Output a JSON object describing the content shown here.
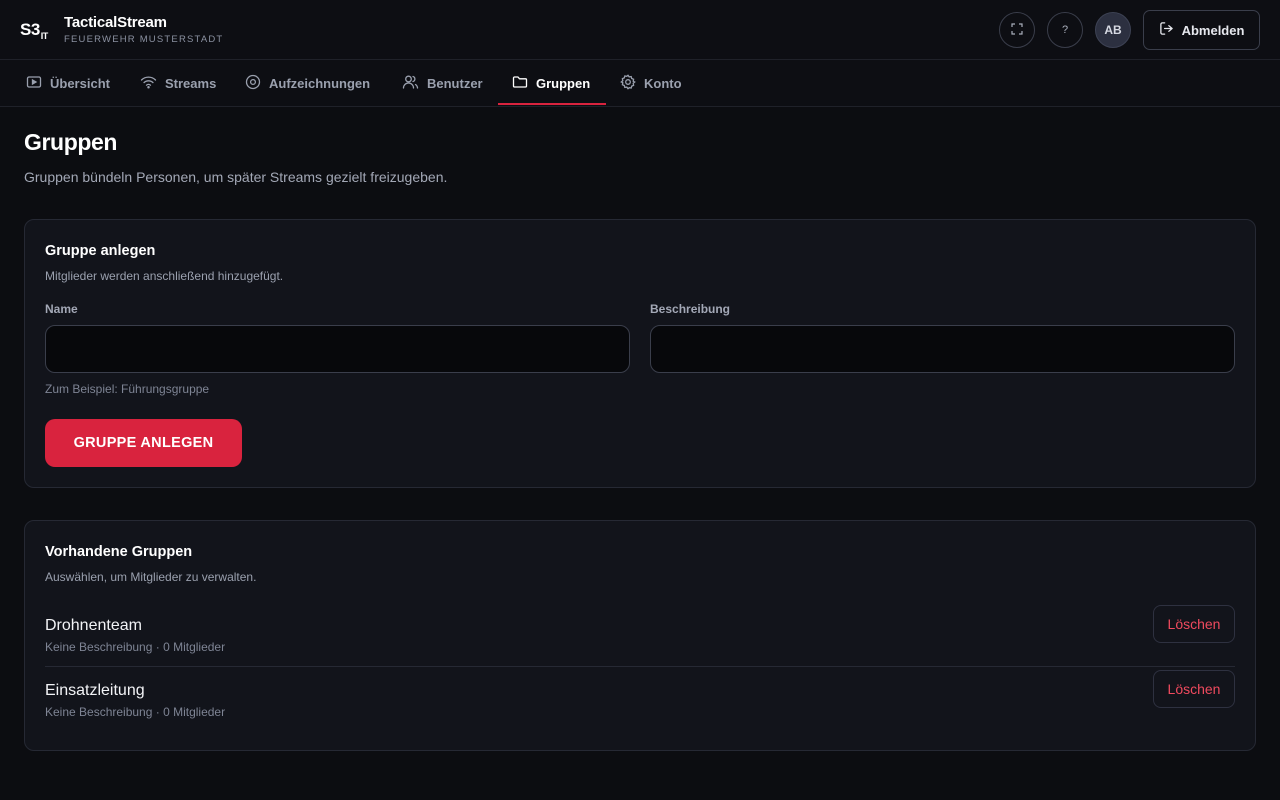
{
  "header": {
    "logo_main": "S3",
    "logo_sub": "IT",
    "app_title": "TacticalStream",
    "org_name": "FEUERWEHR MUSTERSTADT",
    "help_label": "?",
    "avatar_initials": "AB",
    "logout_label": "Abmelden"
  },
  "tabs": [
    {
      "label": "Übersicht",
      "icon": "play-square-icon",
      "active": false
    },
    {
      "label": "Streams",
      "icon": "wifi-icon",
      "active": false
    },
    {
      "label": "Aufzeichnungen",
      "icon": "record-icon",
      "active": false
    },
    {
      "label": "Benutzer",
      "icon": "users-icon",
      "active": false
    },
    {
      "label": "Gruppen",
      "icon": "folder-icon",
      "active": true
    },
    {
      "label": "Konto",
      "icon": "gear-icon",
      "active": false
    }
  ],
  "page": {
    "title": "Gruppen",
    "description": "Gruppen bündeln Personen, um später Streams gezielt freizugeben."
  },
  "create_card": {
    "title": "Gruppe anlegen",
    "subtitle": "Mitglieder werden anschließend hinzugefügt.",
    "name_label": "Name",
    "name_value": "",
    "description_label": "Beschreibung",
    "description_value": "",
    "hint": "Zum Beispiel: Führungsgruppe",
    "submit_label": "GRUPPE ANLEGEN"
  },
  "groups_card": {
    "title": "Vorhandene Gruppen",
    "subtitle": "Auswählen, um Mitglieder zu verwalten.",
    "groups": [
      {
        "name": "Drohnenteam",
        "meta": "Keine Beschreibung · 0 Mitglieder",
        "delete_label": "Löschen"
      },
      {
        "name": "Einsatzleitung",
        "meta": "Keine Beschreibung · 0 Mitglieder",
        "delete_label": "Löschen"
      }
    ]
  },
  "colors": {
    "accent": "#d9233e",
    "danger_text": "#ef4a5e",
    "background": "#0c0d11",
    "card": "#12141b"
  }
}
